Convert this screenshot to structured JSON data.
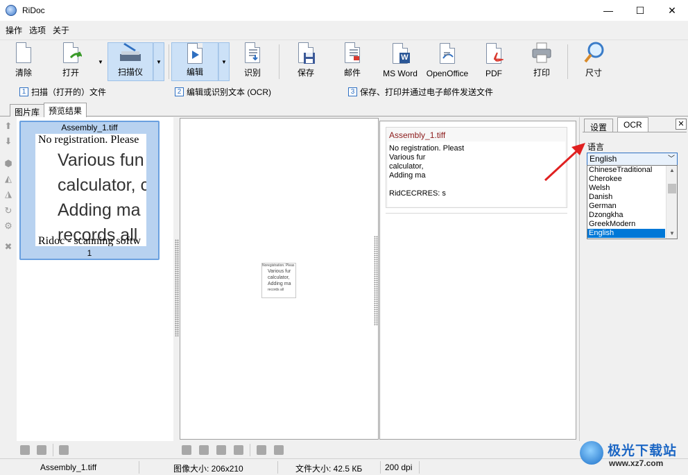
{
  "window": {
    "title": "RiDoc",
    "minimize": "—",
    "maximize": "☐",
    "close": "✕"
  },
  "menu": [
    "操作",
    "选项",
    "关于"
  ],
  "toolbar": {
    "clear": "清除",
    "open": "打开",
    "scanner": "扫描仪",
    "edit": "编辑",
    "recognize": "识别",
    "save": "保存",
    "mail": "邮件",
    "msword": "MS Word",
    "openoffice": "OpenOffice",
    "pdf": "PDF",
    "print": "打印",
    "size": "尺寸"
  },
  "steps": [
    {
      "num": "1",
      "text": "扫描（打开的）文件"
    },
    {
      "num": "2",
      "text": "编辑或识别文本 (OCR)"
    },
    {
      "num": "3",
      "text": "保存、打印并通过电子邮件发送文件"
    }
  ],
  "tabs": {
    "gallery": "图片库",
    "preview": "预览结果"
  },
  "thumbnail": {
    "name": "Assembly_1.tiff",
    "index": "1",
    "lines": [
      "No registration. Please",
      "Various fun",
      "calculator, c",
      "Adding ma",
      "records all",
      "Ridoc - scanning softw"
    ]
  },
  "mini_page": [
    "Noregistration. Pleas",
    "Various fur",
    "calculator,",
    "Adding ma",
    "records all"
  ],
  "ocr_result": {
    "name": "Assembly_1.tiff",
    "text": "No registration. Pleast\nVarious fur\ncalculator,\nAdding ma\n\nRidCECRRES: s"
  },
  "settings": {
    "tab_settings": "设置",
    "tab_ocr": "OCR",
    "close": "✕",
    "language_label": "语言",
    "language_selected": "English",
    "language_options": [
      "ChineseTraditional",
      "Cherokee",
      "Welsh",
      "Danish",
      "German",
      "Dzongkha",
      "GreekModern",
      "English"
    ]
  },
  "status": {
    "file": "Assembly_1.tiff",
    "image_size": "图像大小: 206x210",
    "file_size": "文件大小: 42.5 КБ",
    "dpi": "200 dpi"
  },
  "watermark": {
    "name": "极光下载站",
    "url": "www.xz7.com"
  },
  "colors": {
    "accent": "#0078d7",
    "selection": "#b8d2f0",
    "pressed": "#cce1f7",
    "arrow": "#e02020"
  }
}
